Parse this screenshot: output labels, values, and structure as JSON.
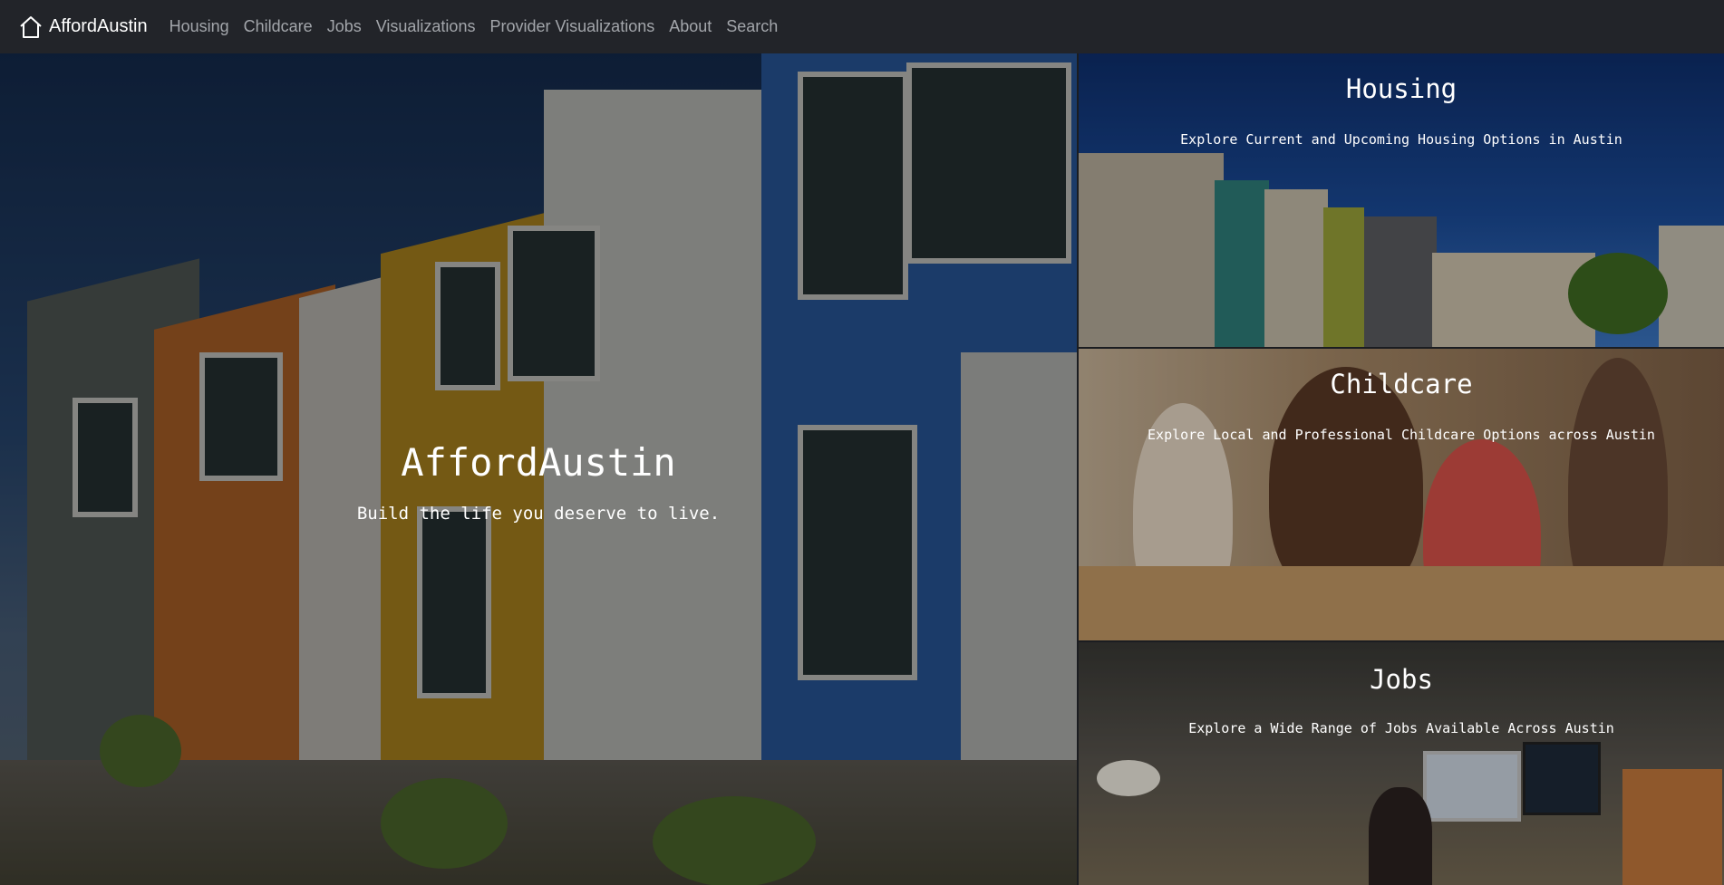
{
  "navbar": {
    "brand": "AffordAustin",
    "brand_icon": "house-icon",
    "links": [
      "Housing",
      "Childcare",
      "Jobs",
      "Visualizations",
      "Provider Visualizations",
      "About",
      "Search"
    ]
  },
  "hero": {
    "title": "AffordAustin",
    "subtitle": "Build the life you deserve to live."
  },
  "cards": [
    {
      "title": "Housing",
      "description": "Explore Current and Upcoming Housing Options in Austin"
    },
    {
      "title": "Childcare",
      "description": "Explore Local and Professional Childcare Options across Austin"
    },
    {
      "title": "Jobs",
      "description": "Explore a Wide Range of Jobs Available Across Austin"
    }
  ],
  "colors": {
    "navbar_bg": "#222429",
    "nav_link": "#a3a6ab",
    "brand_text": "#ffffff"
  }
}
